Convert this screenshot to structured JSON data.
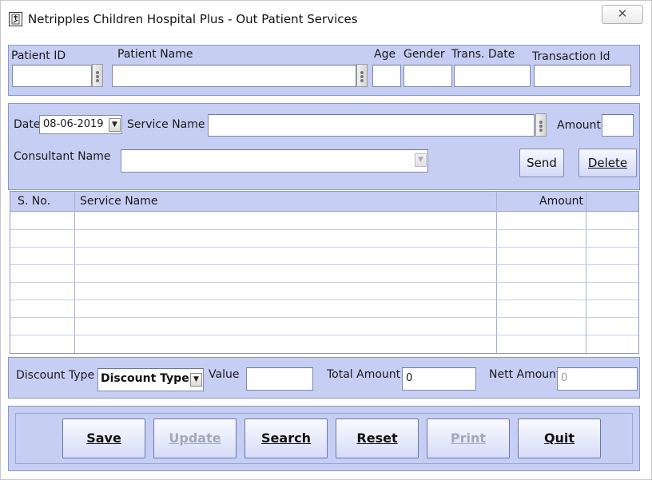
{
  "window": {
    "title": "Netripples Children Hospital Plus - Out Patient Services",
    "close_glyph": "✕",
    "icon": "hospital-app-icon"
  },
  "patient": {
    "patient_id_label": "Patient ID",
    "patient_name_label": "Patient Name",
    "age_label": "Age",
    "gender_label": "Gender",
    "trans_date_label": "Trans. Date",
    "transaction_id_label": "Transaction Id"
  },
  "service": {
    "date_label": "Date",
    "date_value": "08-06-2019",
    "service_name_label": "Service Name",
    "amount_label": "Amount",
    "consultant_name_label": "Consultant Name",
    "send_label": "Send",
    "delete_label": "Delete"
  },
  "grid": {
    "columns": [
      "S. No.",
      "Service Name",
      "Amount"
    ]
  },
  "summary": {
    "discount_type_label": "Discount Type",
    "discount_type_value": "Discount Type",
    "value_label": "Value",
    "total_amount_label": "Total Amount",
    "total_amount_value": "0",
    "nett_amount_label": "Nett Amount",
    "nett_amount_value": "0"
  },
  "actions": {
    "save": "Save",
    "update": "Update",
    "search": "Search",
    "reset": "Reset",
    "print": "Print",
    "quit": "Quit"
  },
  "colors": {
    "panel": "#c6cef4",
    "panel_border": "#8d97c7",
    "disabled_text": "#a3a8bd"
  }
}
